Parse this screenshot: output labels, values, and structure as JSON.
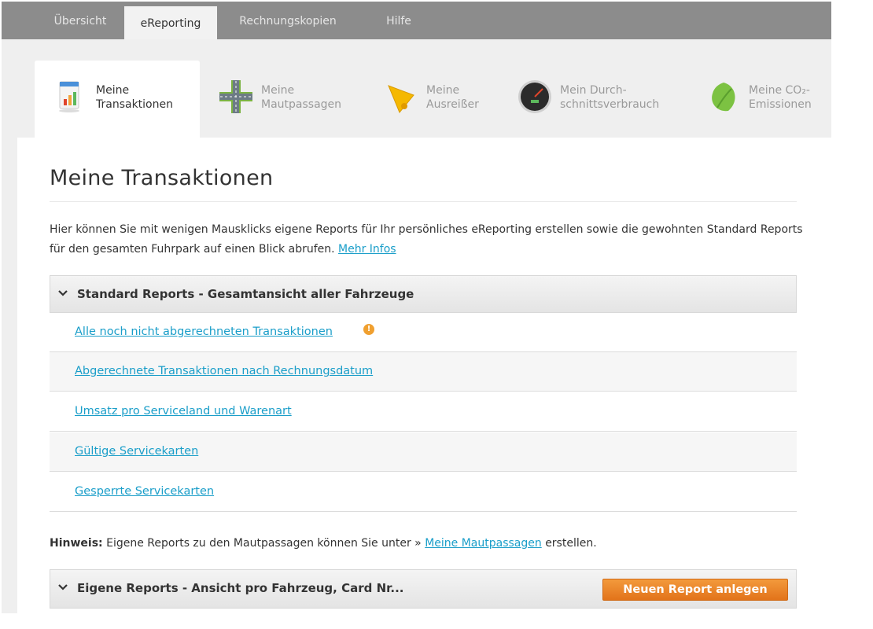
{
  "top_tabs": [
    "Übersicht",
    "eReporting",
    "Rechnungskopien",
    "Hilfe"
  ],
  "sub_tabs": [
    {
      "label": "Meine\nTransaktionen",
      "icon": "bar-chart-icon"
    },
    {
      "label": "Meine\nMautpassagen",
      "icon": "highway-icon"
    },
    {
      "label": "Meine\nAusreißer",
      "icon": "bell-icon"
    },
    {
      "label": "Mein Durch-\nschnittsverbrauch",
      "icon": "speedometer-icon"
    },
    {
      "label": "Meine CO₂-\nEmissionen",
      "icon": "leaf-icon"
    }
  ],
  "page_title": "Meine Transaktionen",
  "intro": {
    "text": "Hier können Sie mit wenigen Mausklicks eigene Reports für Ihr persönliches eReporting erstellen sowie die gewohnten Standard Reports für den gesamten Fuhrpark auf einen Blick abrufen.",
    "link": "Mehr Infos"
  },
  "standard_reports": {
    "header": "Standard Reports - Gesamtansicht aller Fahrzeuge",
    "items": [
      "Alle noch nicht abgerechneten Transaktionen",
      "Abgerechnete Transaktionen nach Rechnungsdatum",
      "Umsatz pro Serviceland und Warenart",
      "Gültige Servicekarten",
      "Gesperrte Servicekarten"
    ]
  },
  "hint": {
    "bold": "Hinweis:",
    "text_before": "Eigene Reports zu den Mautpassagen können Sie unter »",
    "link": "Meine Mautpassagen",
    "text_after": "erstellen."
  },
  "custom_reports": {
    "header": "Eigene Reports - Ansicht pro Fahrzeug, Card Nr...",
    "button": "Neuen Report anlegen"
  },
  "colors": {
    "topbar": "#8c8c8c",
    "link": "#1a9ec9",
    "button": "#e2731a"
  }
}
